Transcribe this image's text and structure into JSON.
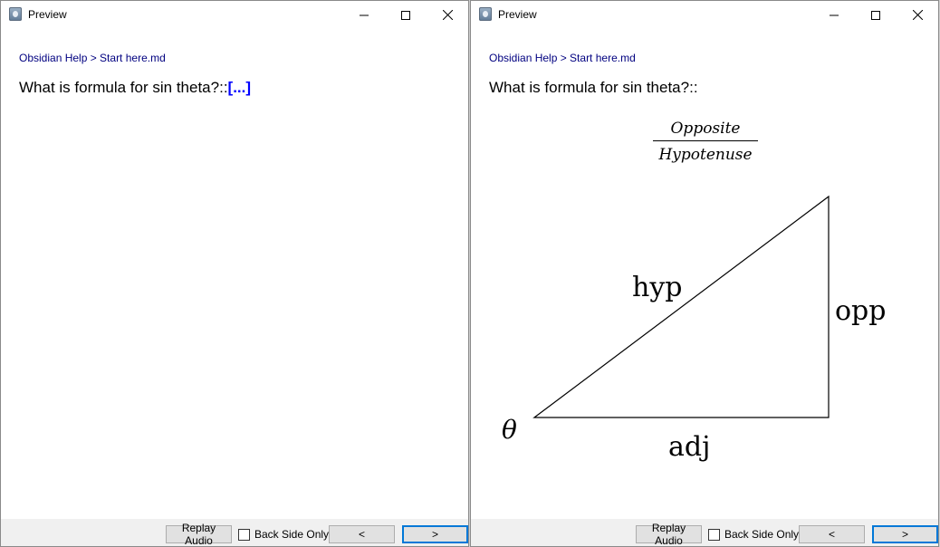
{
  "left_window": {
    "title": "Preview",
    "breadcrumb": "Obsidian Help > Start here.md",
    "question": "What is formula for sin theta?::",
    "cloze": "[...]",
    "buttons": {
      "replay": "Replay Audio",
      "back_side_only": "Back Side Only",
      "prev": "<",
      "next": ">"
    }
  },
  "right_window": {
    "title": "Preview",
    "breadcrumb": "Obsidian Help > Start here.md",
    "question": "What is formula for sin theta?::",
    "formula": {
      "numerator": "Opposite",
      "denominator": "Hypotenuse"
    },
    "triangle": {
      "hyp_label": "hyp",
      "opp_label": "opp",
      "adj_label": "adj",
      "angle_label": "θ"
    },
    "buttons": {
      "replay": "Replay Audio",
      "back_side_only": "Back Side Only",
      "prev": "<",
      "next": ">"
    }
  }
}
